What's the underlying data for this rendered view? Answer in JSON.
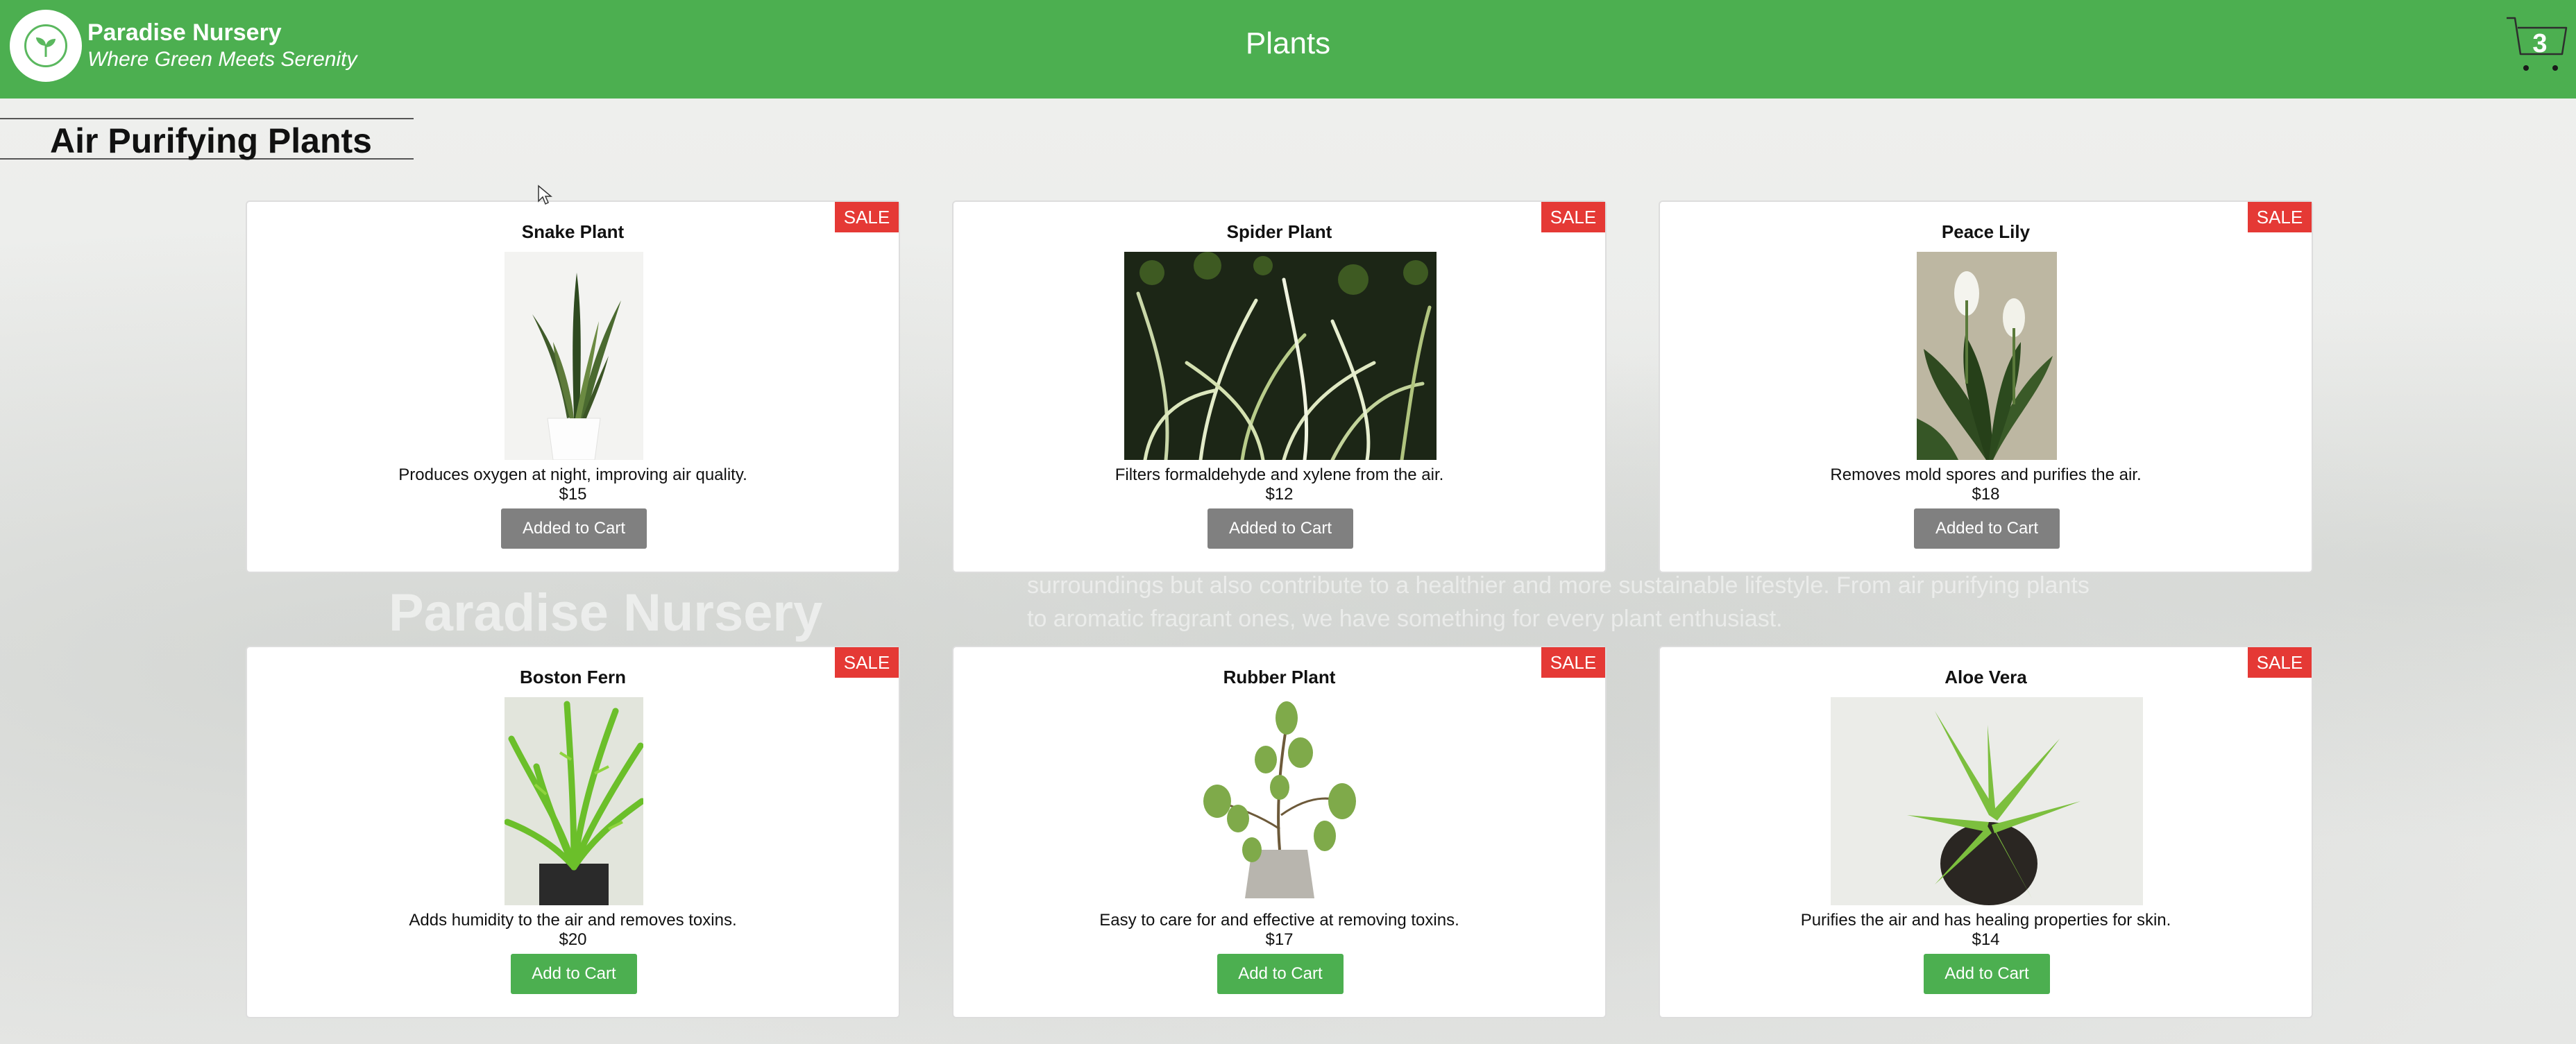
{
  "header": {
    "brand_name": "Paradise Nursery",
    "brand_tagline": "Where Green Meets Serenity",
    "title": "Plants",
    "cart_count": "3",
    "logo_icon": "leaf-icon",
    "cart_icon": "cart-icon"
  },
  "background": {
    "title": "Paradise Nursery",
    "text": "surroundings but also contribute to a healthier and more sustainable lifestyle. From air purifying plants to aromatic fragrant ones, we have something for every plant enthusiast."
  },
  "section": {
    "title": "Air Purifying Plants"
  },
  "plants": [
    {
      "name": "Snake Plant",
      "description": "Produces oxygen at night, improving air quality.",
      "price": "$15",
      "badge": "SALE",
      "button": "Added to Cart",
      "in_cart": true
    },
    {
      "name": "Spider Plant",
      "description": "Filters formaldehyde and xylene from the air.",
      "price": "$12",
      "badge": "SALE",
      "button": "Added to Cart",
      "in_cart": true
    },
    {
      "name": "Peace Lily",
      "description": "Removes mold spores and purifies the air.",
      "price": "$18",
      "badge": "SALE",
      "button": "Added to Cart",
      "in_cart": true
    },
    {
      "name": "Boston Fern",
      "description": "Adds humidity to the air and removes toxins.",
      "price": "$20",
      "badge": "SALE",
      "button": "Add to Cart",
      "in_cart": false
    },
    {
      "name": "Rubber Plant",
      "description": "Easy to care for and effective at removing toxins.",
      "price": "$17",
      "badge": "SALE",
      "button": "Add to Cart",
      "in_cart": false
    },
    {
      "name": "Aloe Vera",
      "description": "Purifies the air and has healing properties for skin.",
      "price": "$14",
      "badge": "SALE",
      "button": "Add to Cart",
      "in_cart": false
    }
  ],
  "colors": {
    "header_bg": "#4caf50",
    "sale_badge": "#e53935",
    "added_button": "#808080",
    "add_button": "#4caf50"
  }
}
